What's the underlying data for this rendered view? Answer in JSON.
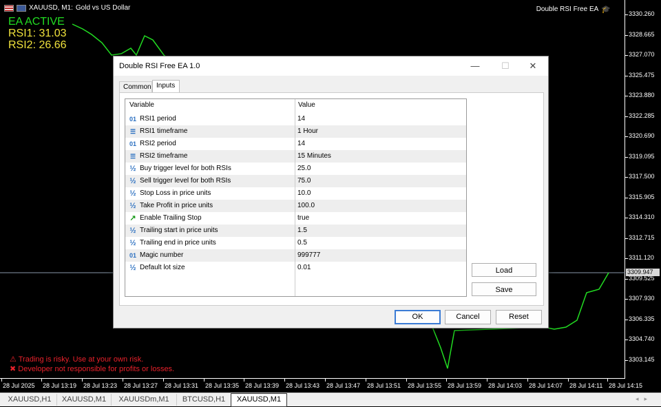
{
  "chart_header": {
    "symbol": "XAUUSD, M1:",
    "description": "Gold vs US Dollar",
    "ea_name": "Double RSI Free EA"
  },
  "overlay": {
    "status": "EA ACTIVE",
    "rsi1": "RSI1: 31.03",
    "rsi2": "RSI2: 26.66",
    "status_color": "#22dd22",
    "rsi_color": "#f0e23c"
  },
  "warnings": {
    "line1": "Trading is risky. Use at your own risk.",
    "line2": "Developer not responsible for profits or losses.",
    "color": "#e8212b"
  },
  "price_axis": {
    "labels": [
      "3330.260",
      "3328.665",
      "3327.070",
      "3325.475",
      "3323.880",
      "3322.285",
      "3320.690",
      "3319.095",
      "3317.500",
      "3315.905",
      "3314.310",
      "3312.715",
      "3311.120",
      "3309.525",
      "3307.930",
      "3306.335",
      "3304.740",
      "3303.145"
    ],
    "current_price": "3309.947"
  },
  "time_axis": {
    "labels": [
      "28 Jul 2025",
      "28 Jul 13:19",
      "28 Jul 13:23",
      "28 Jul 13:27",
      "28 Jul 13:31",
      "28 Jul 13:35",
      "28 Jul 13:39",
      "28 Jul 13:43",
      "28 Jul 13:47",
      "28 Jul 13:51",
      "28 Jul 13:55",
      "28 Jul 13:59",
      "28 Jul 14:03",
      "28 Jul 14:07",
      "28 Jul 14:11",
      "28 Jul 14:15"
    ]
  },
  "chart_tabs": [
    "XAUUSD,H1",
    "XAUUSD,M1",
    "XAUUSDm,M1",
    "BTCUSD,H1",
    "XAUUSD,M1"
  ],
  "dialog": {
    "title": "Double RSI Free EA 1.0",
    "window_buttons": {
      "minimize": "—",
      "maximize": "☐",
      "close": "✕"
    },
    "tabs": [
      "Common",
      "Inputs"
    ],
    "columns": {
      "variable": "Variable",
      "value": "Value"
    },
    "inputs": [
      {
        "icon": "int",
        "name": "RSI1 period",
        "value": "14"
      },
      {
        "icon": "enum",
        "name": "RSI1 timeframe",
        "value": "1 Hour"
      },
      {
        "icon": "int",
        "name": "RSI2 period",
        "value": "14"
      },
      {
        "icon": "enum",
        "name": "RSI2 timeframe",
        "value": "15 Minutes"
      },
      {
        "icon": "double",
        "name": "Buy trigger level for both RSIs",
        "value": "25.0"
      },
      {
        "icon": "double",
        "name": "Sell trigger level for both RSIs",
        "value": "75.0"
      },
      {
        "icon": "double",
        "name": "Stop Loss in price units",
        "value": "10.0"
      },
      {
        "icon": "double",
        "name": "Take Profit in price units",
        "value": "100.0"
      },
      {
        "icon": "bool",
        "name": "Enable Trailing Stop",
        "value": "true"
      },
      {
        "icon": "double",
        "name": "Trailing start in price units",
        "value": "1.5"
      },
      {
        "icon": "double",
        "name": "Trailing end in price units",
        "value": "0.5"
      },
      {
        "icon": "int",
        "name": "Magic number",
        "value": "999777"
      },
      {
        "icon": "double",
        "name": "Default lot size",
        "value": "0.01"
      }
    ],
    "icon_glyphs": {
      "int": "01",
      "enum": "☰",
      "double": "½",
      "bool": "↗"
    },
    "side_buttons": {
      "load": "Load",
      "save": "Save"
    },
    "bottom_buttons": {
      "ok": "OK",
      "cancel": "Cancel",
      "reset": "Reset"
    }
  },
  "chart_colors": {
    "line": "#22dd22",
    "current_price_line": "#8899aa"
  }
}
